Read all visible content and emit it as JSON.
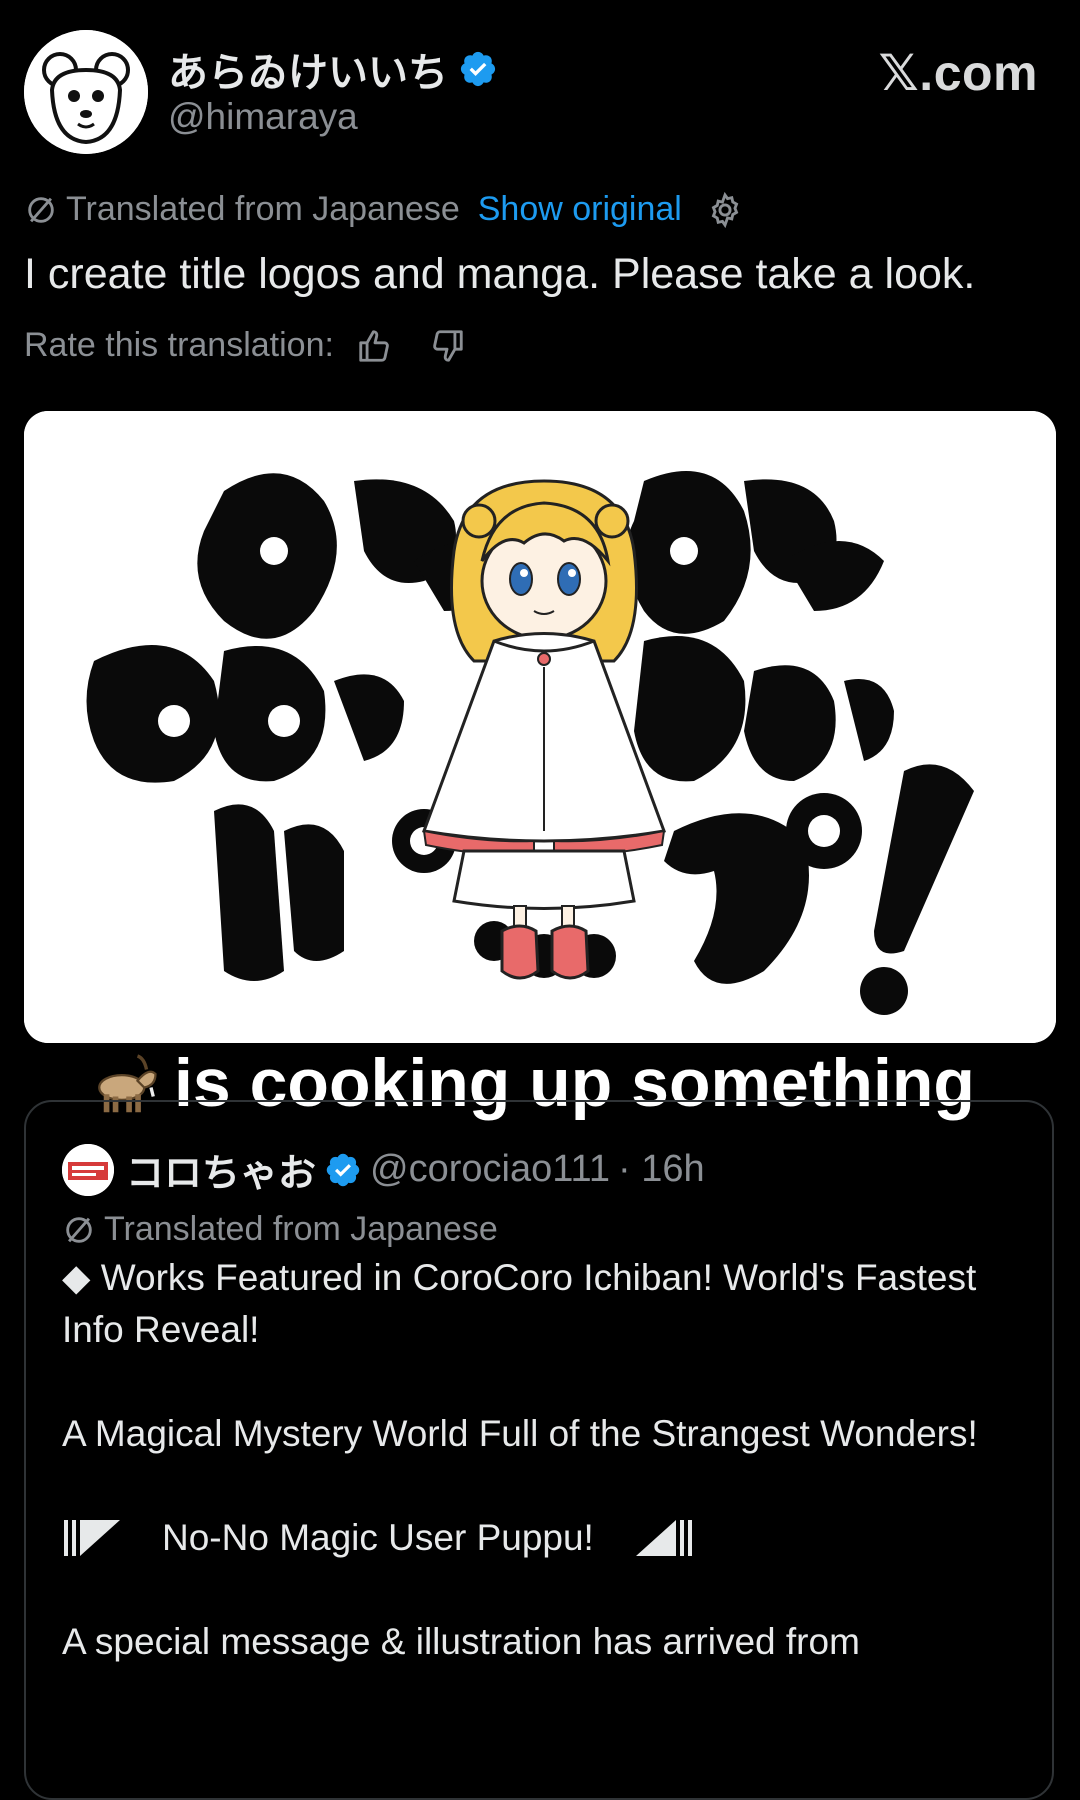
{
  "profile": {
    "display_name": "あらゐけいいち",
    "handle": "@himaraya"
  },
  "brand": "𝕏.com",
  "translation": {
    "label": "Translated from Japanese",
    "show_original": "Show original",
    "text": "I create title logos and manga. Please take a look.",
    "rate_label": "Rate this translation:"
  },
  "caption": {
    "text": "is cooking up something"
  },
  "quote": {
    "name": "コロちゃお",
    "handle": "@corociao111",
    "time": "· 16h",
    "translated_label": "Translated from Japanese",
    "para1": "◆ Works Featured in CoroCoro Ichiban! World's Fastest Info Reveal!",
    "para2": "A Magical Mystery World Full of the Strangest Wonders!",
    "series_title": "No-No Magic User Puppu!",
    "para4": "A special message & illustration has arrived from"
  },
  "colors": {
    "accent": "#1d9bf0",
    "muted": "#8b8f94",
    "background": "#000000"
  },
  "icons": [
    "verified-icon",
    "translate-icon",
    "gear-icon",
    "thumb-up-icon",
    "thumb-down-icon",
    "goat-icon"
  ]
}
